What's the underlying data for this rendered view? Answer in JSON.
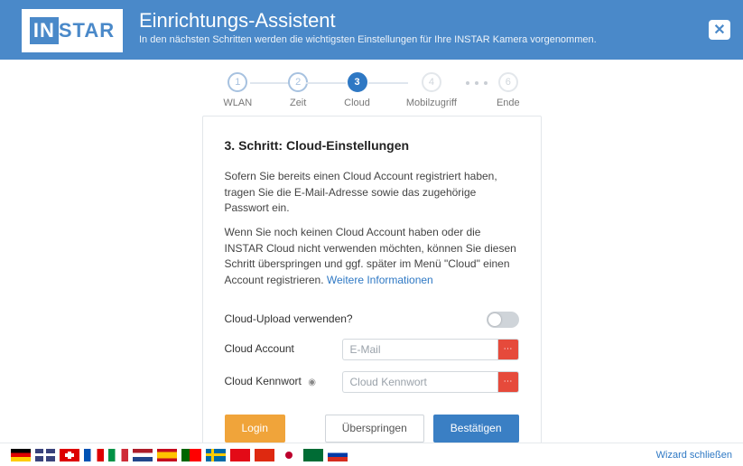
{
  "header": {
    "logo_pre": "IN",
    "logo_post": "STAR",
    "title": "Einrichtungs-Assistent",
    "subtitle": "In den nächsten Schritten werden die wichtigsten Einstellungen für Ihre INSTAR Kamera vorgenommen.",
    "close_glyph": "✕"
  },
  "steps": [
    {
      "num": "1",
      "label": "WLAN",
      "state": "past"
    },
    {
      "num": "2",
      "label": "Zeit",
      "state": "past"
    },
    {
      "num": "3",
      "label": "Cloud",
      "state": "active"
    },
    {
      "num": "4",
      "label": "Mobilzugriff",
      "state": "dim"
    },
    {
      "num": "6",
      "label": "Ende",
      "state": "dim"
    }
  ],
  "card": {
    "heading": "3. Schritt: Cloud-Einstellungen",
    "para1": "Sofern Sie bereits einen Cloud Account registriert haben, tragen Sie die E-Mail-Adresse sowie das zugehörige Passwort ein.",
    "para2": "Wenn Sie noch keinen Cloud Account haben oder die INSTAR Cloud nicht verwenden möchten, können Sie diesen Schritt überspringen und ggf. später im Menü \"Cloud\" einen Account registrieren. ",
    "link": "Weitere Informationen",
    "toggle_label": "Cloud-Upload verwenden?",
    "account_label": "Cloud Account",
    "account_placeholder": "E-Mail",
    "password_label": "Cloud Kennwort",
    "password_placeholder": "Cloud Kennwort",
    "btn_login": "Login",
    "btn_skip": "Überspringen",
    "btn_confirm": "Bestätigen"
  },
  "footer": {
    "wizard_close": "Wizard schließen",
    "flags": [
      "de",
      "en",
      "ch",
      "fr",
      "it",
      "nl",
      "es",
      "pt",
      "se",
      "tr",
      "zh",
      "jp",
      "ar",
      "ru"
    ]
  }
}
